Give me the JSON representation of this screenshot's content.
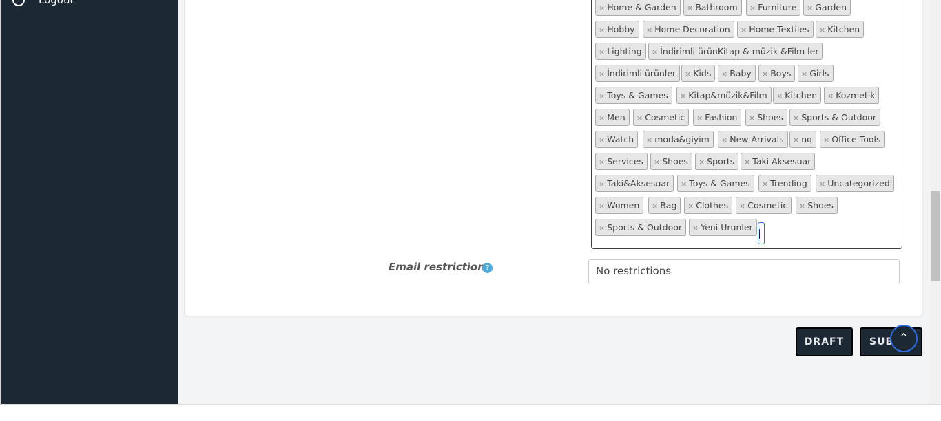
{
  "sidebar": {
    "logout_label": "Logout"
  },
  "categories": {
    "tags": [
      "Home & Garden",
      "Bathroom",
      "Furniture",
      "Garden",
      "Hobby",
      "Home Decoration",
      "Home Textiles",
      "Kitchen",
      "Lighting",
      "İndirimli ürünKitap & müzik &Film ler",
      "İndirimli ürünler",
      "Kids",
      "Baby",
      "Boys",
      "Girls",
      "Toys & Games",
      "Kitap&müzik&Film",
      "Kitchen",
      "Kozmetik",
      "Men",
      "Cosmetic",
      "Fashion",
      "Shoes",
      "Sports & Outdoor",
      "Watch",
      "moda&giyim",
      "New Arrivals",
      "nq",
      "Office Tools",
      "Services",
      "Shoes",
      "Sports",
      "Taki Aksesuar",
      "Taki&Aksesuar",
      "Toys & Games",
      "Trending",
      "Uncategorized",
      "Women",
      "Bag",
      "Clothes",
      "Cosmetic",
      "Shoes",
      "Sports & Outdoor",
      "Yeni Urunler"
    ],
    "remove_glyph": "×"
  },
  "email_restrictions": {
    "label": "Email restrictions",
    "help_glyph": "?",
    "placeholder": "No restrictions"
  },
  "actions": {
    "draft_label": "DRAFT",
    "submit_label": "SUBMIT"
  },
  "icons": {
    "scroll_top": "chevron-up-icon",
    "power": "power-icon",
    "help": "help-icon"
  },
  "colors": {
    "sidebar": "#1c2935",
    "accent": "#2d6cdf",
    "help": "#4ea8d8"
  }
}
